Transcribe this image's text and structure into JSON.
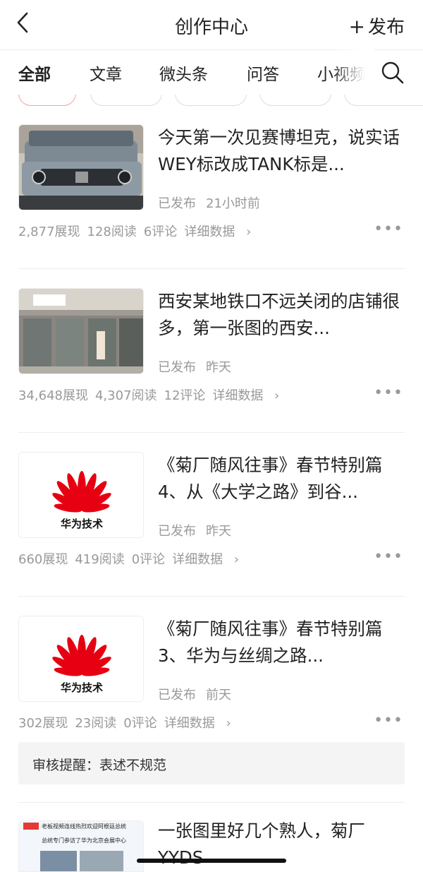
{
  "header": {
    "title": "创作中心",
    "publish_label": "发布"
  },
  "tabs": [
    "全部",
    "文章",
    "微头条",
    "问答",
    "小视频"
  ],
  "colors": {
    "accent": "#e53935",
    "muted": "#999999",
    "divider": "#eeeeee"
  },
  "icons": {
    "back": "chevron-left-icon",
    "search": "search-icon",
    "more": "more-dots-icon",
    "chevron": "chevron-right-icon"
  },
  "items": [
    {
      "title": "今天第一次见赛博坦克，说实话WEY标改成TANK标是...",
      "status": "已发布",
      "time": "21小时前",
      "impressions": "2,877展现",
      "reads": "128阅读",
      "comments": "6评论",
      "detail": "详细数据"
    },
    {
      "title": "西安某地铁口不远关闭的店铺很多，第一张图的西安...",
      "status": "已发布",
      "time": "昨天",
      "impressions": "34,648展现",
      "reads": "4,307阅读",
      "comments": "12评论",
      "detail": "详细数据"
    },
    {
      "title": "《菊厂随风往事》春节特别篇 4、从《大学之路》到谷...",
      "status": "已发布",
      "time": "昨天",
      "thumb_label": "华为技术",
      "impressions": "660展现",
      "reads": "419阅读",
      "comments": "0评论",
      "detail": "详细数据"
    },
    {
      "title": "《菊厂随风往事》春节特别篇 3、华为与丝绸之路...",
      "status": "已发布",
      "time": "前天",
      "thumb_label": "华为技术",
      "impressions": "302展现",
      "reads": "23阅读",
      "comments": "0评论",
      "detail": "详细数据"
    }
  ],
  "audit_notice": "审核提醒：表述不规范",
  "partial_item": {
    "title": "一张图里好几个熟人，菊厂YYDS",
    "thumb_line1": "老板视频连线热烈欢迎阿根廷总统",
    "thumb_line2": "总统专门参访了华为北京会展中心"
  }
}
